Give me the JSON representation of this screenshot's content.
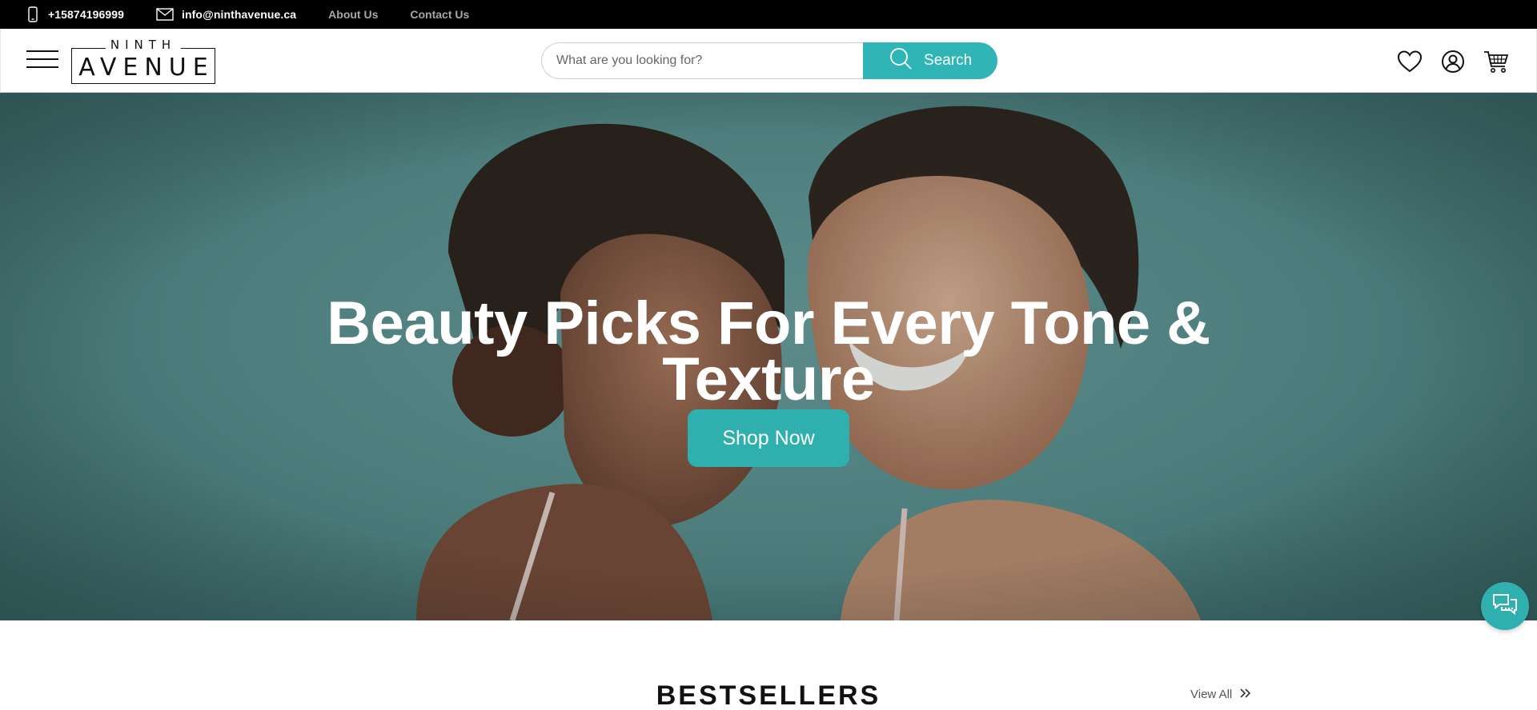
{
  "topbar": {
    "phone": "+15874196999",
    "email": "info@ninthavenue.ca",
    "links": [
      "About Us",
      "Contact Us"
    ]
  },
  "header": {
    "logo_top": "NINTH",
    "logo_main": "AVENUE",
    "search_placeholder": "What are you looking for?",
    "search_label": "Search",
    "icons": [
      "heart-icon",
      "user-icon",
      "cart-icon"
    ]
  },
  "hero": {
    "title_line1": "Beauty Picks For Every Tone &",
    "title_line2": "Texture",
    "cta_label": "Shop Now"
  },
  "bestsellers": {
    "title": "BESTSELLERS",
    "view_all": "View All"
  },
  "colors": {
    "accent": "#2fb5b5",
    "topbar_bg": "#000000",
    "hero_bg": "#5e9190"
  }
}
